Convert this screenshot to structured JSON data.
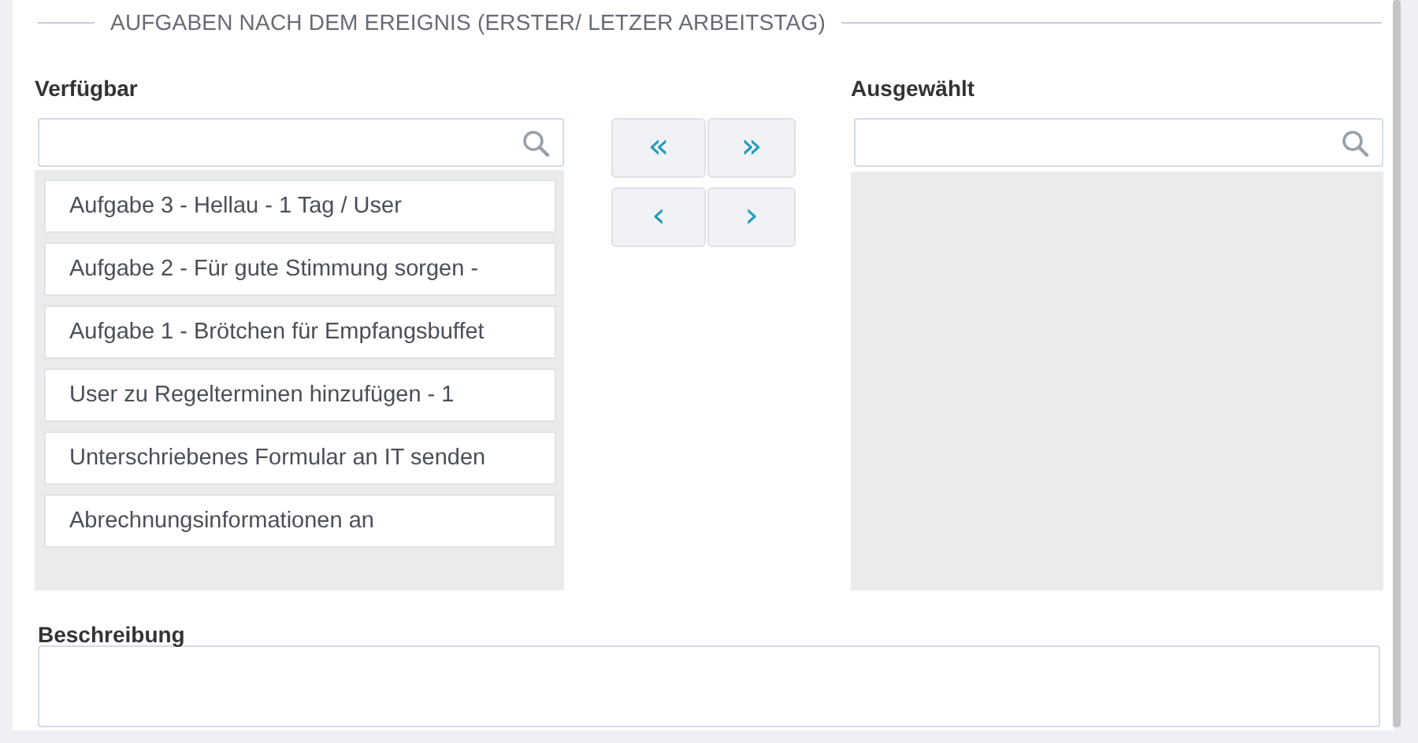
{
  "section": {
    "title": "AUFGABEN NACH DEM EREIGNIS (ERSTER/ LETZER ARBEITSTAG)"
  },
  "available": {
    "label": "Verfügbar",
    "items": [
      {
        "label": "Aufgabe 3 - Hellau - 1 Tag / User"
      },
      {
        "label": "Aufgabe 2 - Für gute Stimmung sorgen -"
      },
      {
        "label": "Aufgabe 1 - Brötchen für Empfangsbuffet"
      },
      {
        "label": "User zu Regelterminen hinzufügen - 1"
      },
      {
        "label": "Unterschriebenes Formular an IT senden"
      },
      {
        "label": "Abrechnungsinformationen an"
      }
    ]
  },
  "move_buttons": [
    {
      "symbol": "«",
      "kind": "all-left"
    },
    {
      "symbol": "»",
      "kind": "all-right"
    },
    {
      "symbol": "‹",
      "kind": "left"
    },
    {
      "symbol": "›",
      "kind": "right"
    }
  ],
  "selected": {
    "label": "Ausgewählt"
  },
  "description": {
    "label": "Beschreibung"
  }
}
